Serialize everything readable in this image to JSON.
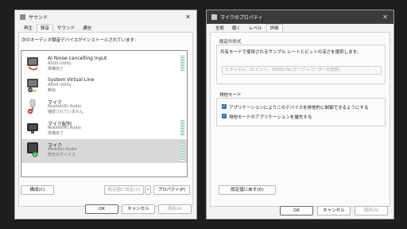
{
  "left_window": {
    "title": "サウンド",
    "tabs": [
      "再生",
      "録音",
      "サウンド",
      "通信"
    ],
    "instruction": "次のオーディオ録音デバイスがインストールされています:",
    "devices": [
      {
        "name": "AI Noise-cancelling Input",
        "driver": "ASUS Utility",
        "status": "準備完了"
      },
      {
        "name": "System Virtual Line",
        "driver": "ASUS Utility",
        "status": "無効"
      },
      {
        "name": "マイク",
        "driver": "Realtek(R) Audio",
        "status": "接続されていません"
      },
      {
        "name": "マイク配列",
        "driver": "Realtek(R) Audio",
        "status": "準備完了"
      },
      {
        "name": "マイク",
        "driver": "Wireless Audio",
        "status": "既定のデバイス"
      }
    ],
    "configure_label": "構成(C)",
    "set_default_label": "既定値に設定(S)",
    "set_default_arrow": "▾",
    "properties_label": "プロパティ(P)",
    "ok_label": "OK",
    "cancel_label": "キャンセル",
    "apply_label": "適用(A)"
  },
  "right_window": {
    "title": "マイクのプロパティ",
    "tabs": [
      "全般",
      "聴く",
      "レベル",
      "詳細"
    ],
    "default_format": {
      "header": "既定の形式",
      "description": "共有モードで使用されるサンプル レートとビットの深さを選択します。",
      "selected": "1 チャネル、16 ビット、16000 Hz (テープ レコーダーの音質)"
    },
    "exclusive_mode": {
      "header": "排他モード",
      "option1": "アプリケーションによりこのデバイスを排他的に制御できるようにする",
      "option2": "排他モードのアプリケーションを優先する"
    },
    "restore_label": "既定値に戻す(D)",
    "ok_label": "OK",
    "cancel_label": "キャンセル",
    "apply_label": "適用(A)"
  },
  "icons": {
    "close": "✕",
    "check": "✓",
    "chevron": "⌄"
  },
  "colors": {
    "accent": "#2f6fb3",
    "default_check": "#1f9d3f",
    "disabled_red": "#d32f2f",
    "level_meter": "#7fc6a6"
  }
}
